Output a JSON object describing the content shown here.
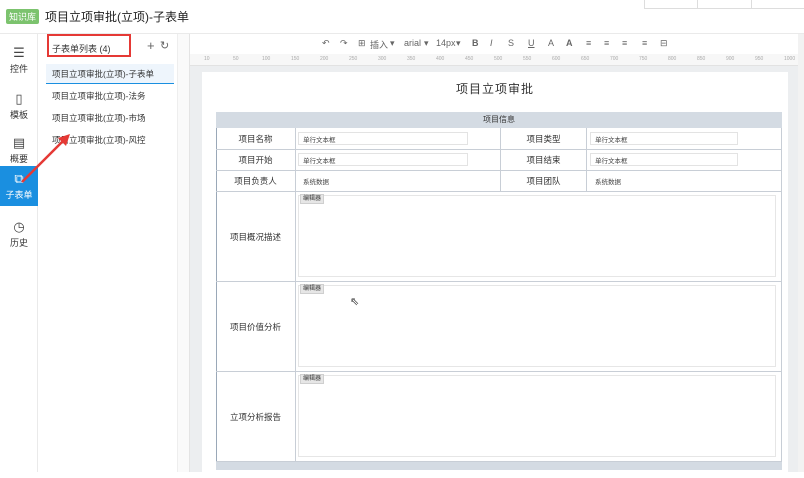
{
  "titlebar": {
    "badge": "知识库",
    "title": "项目立项审批(立项)-子表单"
  },
  "leftnav": [
    {
      "label": "控件",
      "icon": "list-icon"
    },
    {
      "label": "模板",
      "icon": "template-icon"
    },
    {
      "label": "概要",
      "icon": "outline-icon"
    },
    {
      "label": "子表单",
      "icon": "subform-icon",
      "active": true
    },
    {
      "label": "历史",
      "icon": "history-icon"
    }
  ],
  "listpanel": {
    "title": "子表单列表 (4)",
    "items": [
      "项目立项审批(立项)-子表单",
      "项目立项审批(立项)-法务",
      "项目立项审批(立项)-市场",
      "项目立项审批(立项)-风控"
    ]
  },
  "toolbar": {
    "insert": "插入",
    "font": "arial",
    "size": "14px"
  },
  "ruler_ticks": [
    "10",
    "50",
    "100",
    "150",
    "200",
    "250",
    "300",
    "350",
    "400",
    "450",
    "500",
    "550",
    "600",
    "650",
    "700",
    "750",
    "800",
    "850",
    "900",
    "950",
    "1000"
  ],
  "document": {
    "title": "项目立项审批",
    "section_header": "项目信息",
    "rows": [
      {
        "label1": "项目名称",
        "value1": "单行文本框",
        "label2": "项目类型",
        "value2": "单行文本框"
      },
      {
        "label1": "项目开始",
        "value1": "单行文本框",
        "label2": "项目结束",
        "value2": "单行文本框"
      },
      {
        "label1": "项目负责人",
        "value1": "系统数据",
        "label2": "项目团队",
        "value2": "系统数据"
      }
    ],
    "editors": [
      {
        "label": "项目概况描述",
        "tag": "编辑器"
      },
      {
        "label": "项目价值分析",
        "tag": "编辑器"
      },
      {
        "label": "立项分析报告",
        "tag": "编辑器"
      }
    ]
  },
  "colors": {
    "accent": "#1a8fe0",
    "highlight_box": "#e53935",
    "arrow": "#e53935"
  }
}
